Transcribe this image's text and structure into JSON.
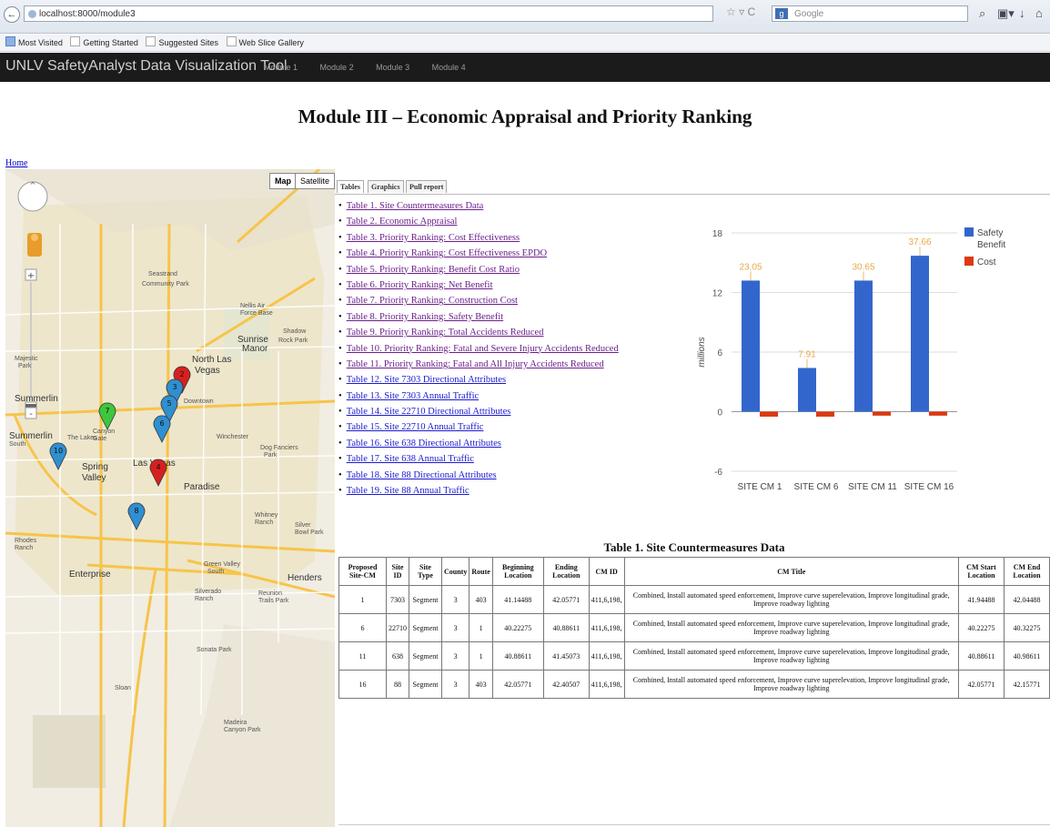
{
  "browser": {
    "url": "localhost:8000/module3",
    "search_placeholder": "Google",
    "search_engine_letter": "g",
    "back_glyph": "←",
    "nav_icons": "☆ ▿ C",
    "search_glyph": "⌕",
    "toolbar_glyphs": [
      "▣▾",
      "↓",
      "⌂"
    ],
    "bookmarks": [
      "Most Visited",
      "Getting Started",
      "Suggested Sites",
      "Web Slice Gallery"
    ]
  },
  "app": {
    "title": "UNLV SafetyAnalyst Data Visualization Tool",
    "nav": [
      "Module 1",
      "Module 2",
      "Module 3",
      "Module 4"
    ]
  },
  "page": {
    "title": "Module III – Economic Appraisal and Priority Ranking",
    "home_link": "Home"
  },
  "map": {
    "type_buttons": [
      "Map",
      "Satellite"
    ],
    "labels": [
      "Seastrand",
      "Community Park",
      "Nellis Air",
      "Force Base",
      "Sunrise",
      "Manor",
      "Shadow",
      "Rock Park",
      "North Las",
      "Vegas",
      "Summerlin",
      "Majestic",
      "Park",
      "Canyon",
      "Gate",
      "The Lakes",
      "Summerlin",
      "South",
      "Spring",
      "Valley",
      "Las Vegas",
      "Winchester",
      "Dog Fanciers",
      "Park",
      "Paradise",
      "Whitney",
      "Ranch",
      "Silver",
      "Bowl Park",
      "Rhodes",
      "Ranch",
      "Enterprise",
      "Green Valley",
      "South",
      "Henders",
      "Silverado",
      "Ranch",
      "Reunion",
      "Trails Park",
      "Sonata Park",
      "Sloan",
      "Madeira",
      "Canyon Park",
      "Downtown"
    ],
    "markers": [
      {
        "label": "2",
        "color": "#d62020"
      },
      {
        "label": "3",
        "color": "#2f8fd0"
      },
      {
        "label": "5",
        "color": "#2f8fd0"
      },
      {
        "label": "6",
        "color": "#2f8fd0"
      },
      {
        "label": "7",
        "color": "#3ec63e"
      },
      {
        "label": "10",
        "color": "#2f8fd0"
      },
      {
        "label": "4",
        "color": "#d62020"
      },
      {
        "label": "8",
        "color": "#2f8fd0"
      }
    ]
  },
  "tabs": [
    "Tables",
    "Graphics",
    "Pull report"
  ],
  "table_links": [
    {
      "label": "Table 1. Site Countermeasures Data",
      "visited": true
    },
    {
      "label": "Table 2. Economic Appraisal",
      "visited": true
    },
    {
      "label": "Table 3. Priority Ranking: Cost Effectiveness",
      "visited": true
    },
    {
      "label": "Table 4. Priority Ranking: Cost Effectiveness EPDO",
      "visited": true
    },
    {
      "label": "Table 5. Priority Ranking: Benefit Cost Ratio",
      "visited": true
    },
    {
      "label": "Table 6. Priority Ranking: Net Benefit",
      "visited": true
    },
    {
      "label": "Table 7. Priority Ranking: Construction Cost",
      "visited": true
    },
    {
      "label": "Table 8. Priority Ranking: Safety Benefit",
      "visited": true
    },
    {
      "label": "Table 9. Priority Ranking: Total Accidents Reduced",
      "visited": true
    },
    {
      "label": "Table 10. Priority Ranking: Fatal and Severe Injury Accidents Reduced",
      "visited": true
    },
    {
      "label": "Table 11. Priority Ranking: Fatal and All Injury Accidents Reduced",
      "visited": true
    },
    {
      "label": "Table 12. Site 7303 Directional Attributes",
      "visited": false
    },
    {
      "label": "Table 13. Site 7303 Annual Traffic",
      "visited": false
    },
    {
      "label": "Table 14. Site 22710 Directional Attributes",
      "visited": false
    },
    {
      "label": "Table 15. Site 22710 Annual Traffic",
      "visited": false
    },
    {
      "label": "Table 16. Site 638 Directional Attributes",
      "visited": false
    },
    {
      "label": "Table 17. Site 638 Annual Traffic",
      "visited": false
    },
    {
      "label": "Table 18. Site 88 Directional Attributes",
      "visited": false
    },
    {
      "label": "Table 19. Site 88 Annual Traffic",
      "visited": false
    }
  ],
  "chart_data": {
    "type": "bar",
    "categories": [
      "SITE CM 1",
      "SITE CM 6",
      "SITE CM 11",
      "SITE CM 16"
    ],
    "series": [
      {
        "name": "Safety Benefit",
        "values": [
          23.05,
          7.91,
          30.65,
          37.66
        ],
        "color": "#3366cc"
      },
      {
        "name": "Cost",
        "values": [
          -0.5,
          -0.5,
          -0.4,
          -0.4
        ],
        "color": "#dc3912"
      }
    ],
    "data_labels": [
      "23.05",
      "7.91",
      "30.65",
      "37.66"
    ],
    "bar_heights_axis_values": [
      13.2,
      4.4,
      13.2,
      15.7
    ],
    "ylabel": "millions",
    "yticks": [
      -6,
      0,
      6,
      12,
      18
    ],
    "ylim": [
      -6,
      18
    ],
    "grid": true,
    "legend": "right"
  },
  "data_table": {
    "title": "Table 1. Site Countermeasures Data",
    "headers": [
      "Proposed Site-CM",
      "Site ID",
      "Site Type",
      "County",
      "Route",
      "Beginning Location",
      "Ending Location",
      "CM ID",
      "CM Title",
      "CM Start Location",
      "CM End Location"
    ],
    "rows": [
      [
        "1",
        "7303",
        "Segment",
        "3",
        "403",
        "41.14488",
        "42.05771",
        "411,6,198,",
        "Combined, Install automated speed enforcement, Improve curve superelevation, Improve longitudinal grade, Improve roadway lighting",
        "41.94488",
        "42.04488"
      ],
      [
        "6",
        "22710",
        "Segment",
        "3",
        "1",
        "40.22275",
        "40.88611",
        "411,6,198,",
        "Combined, Install automated speed enforcement, Improve curve superelevation, Improve longitudinal grade, Improve roadway lighting",
        "40.22275",
        "40.32275"
      ],
      [
        "11",
        "638",
        "Segment",
        "3",
        "1",
        "40.88611",
        "41.45073",
        "411,6,198,",
        "Combined, Install automated speed enforcement, Improve curve superelevation, Improve longitudinal grade, Improve roadway lighting",
        "40.88611",
        "40.98611"
      ],
      [
        "16",
        "88",
        "Segment",
        "3",
        "403",
        "42.05771",
        "42.40507",
        "411,6,198,",
        "Combined, Install automated speed enforcement, Improve curve superelevation, Improve longitudinal grade, Improve roadway lighting",
        "42.05771",
        "42.15771"
      ]
    ]
  }
}
